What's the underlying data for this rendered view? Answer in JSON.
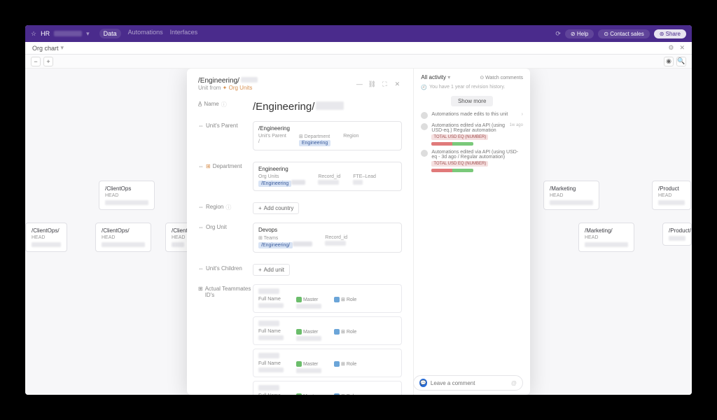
{
  "topbar": {
    "workspace": "HR",
    "tabs": {
      "data": "Data",
      "automations": "Automations",
      "interfaces": "Interfaces"
    },
    "help": "⊘ Help",
    "contact": "⊙ Contact sales",
    "share": "⊛ Share"
  },
  "subheader": {
    "title": "Org chart"
  },
  "toolbar": {
    "minus": "−",
    "plus": "+"
  },
  "canvas": {
    "cards": {
      "clientops": "/ClientOps",
      "clientops_sub": "/ClientOps/",
      "clienti": "/Clienti",
      "marketing": "/Marketing",
      "marketing_sub": "/Marketing/",
      "product": "/Product",
      "product_sub": "/Product/"
    },
    "head_label": "HEAD"
  },
  "modal": {
    "title": "/Engineering/",
    "breadcrumb": {
      "prefix": "Unit from ",
      "link": "✦ Org Units"
    },
    "fields": {
      "name_label": "Name",
      "name_value": "/Engineering/",
      "unit_parent_label": "Unit's Parent",
      "department_label": "Department",
      "region_label": "Region",
      "org_unit_label": "Org Unit",
      "units_children_label": "Unit's Children",
      "teammates_label": "Actual Teammates ID's"
    },
    "parent": {
      "title": "/Engineering",
      "cols": {
        "c1": "Unit's Parent",
        "c2": "⊞ Department",
        "c3": "Region"
      },
      "vals": {
        "v1": "/",
        "v2": "Engineering"
      }
    },
    "department": {
      "title": "Engineering",
      "cols": {
        "c1": "Org Units",
        "c2": "Record_id",
        "c3": "FTE–Lead"
      },
      "vals": {
        "v1": "/Engineering"
      }
    },
    "orgunit": {
      "title": "Devops",
      "cols": {
        "c1": "⊞ Teams",
        "c2": "Record_id"
      },
      "vals": {
        "v1": "/Engineering/"
      }
    },
    "add_country": "Add country",
    "add_unit": "Add unit",
    "tm_cols": {
      "full_name": "Full Name",
      "master": "Master",
      "role": "Role"
    }
  },
  "side": {
    "all_activity": "All activity",
    "watch": "⊙ Watch comments",
    "history_note": "You have 1 year of revision history.",
    "show_more": "Show more",
    "items": {
      "a1": "Automations made edits to this unit",
      "a2": "Automations edited via API (using USD-eq.) Regular automation",
      "a3": "Automations edited via API (using USD-eq - 3d ago / Regular automation)"
    },
    "badge_label": "TOTAL USD EQ (NUMBER)",
    "time1": "1w ago",
    "comment_placeholder": "Leave a comment"
  }
}
